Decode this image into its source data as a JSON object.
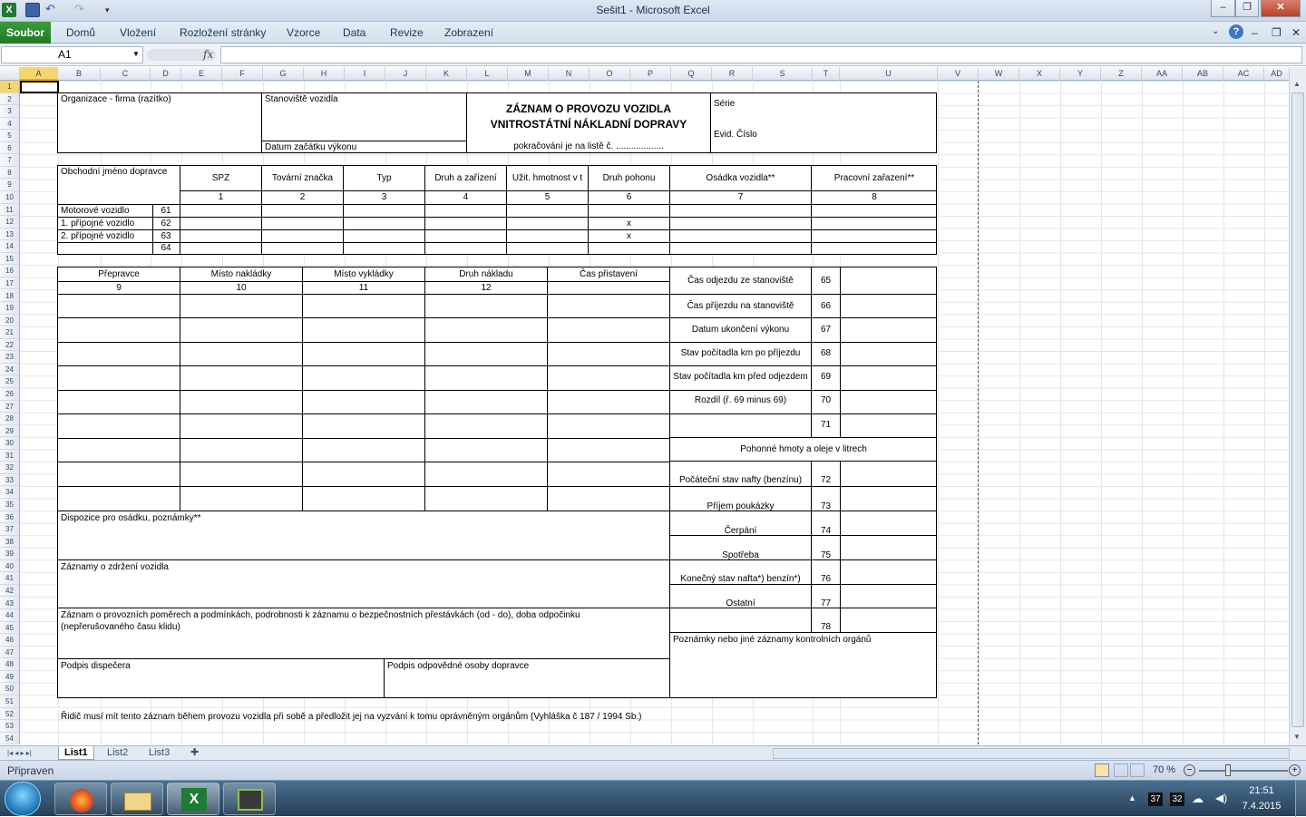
{
  "window": {
    "title": "Sešit1 - Microsoft Excel"
  },
  "ribbon": {
    "file": "Soubor",
    "tabs": [
      "Domů",
      "Vložení",
      "Rozložení stránky",
      "Vzorce",
      "Data",
      "Revize",
      "Zobrazení"
    ]
  },
  "formula_bar": {
    "name_box": "A1",
    "fx": "fx",
    "content": ""
  },
  "columns": [
    "A",
    "B",
    "C",
    "D",
    "E",
    "F",
    "G",
    "H",
    "I",
    "J",
    "K",
    "L",
    "M",
    "N",
    "O",
    "P",
    "Q",
    "R",
    "S",
    "T",
    "U",
    "V",
    "W",
    "X",
    "Y",
    "Z",
    "AA",
    "AB",
    "AC",
    "AD"
  ],
  "form": {
    "org": "Organizace - firma (razítko)",
    "stanoviste": "Stanoviště vozidla",
    "datum_zacatku": "Datum začátku výkonu",
    "title1": "ZÁZNAM O PROVOZU VOZIDLA",
    "title2": "VNITROSTÁTNÍ NÁKLADNÍ DOPRAVY",
    "pokracovani": "pokračování je na listě č. ...................",
    "serie": "Série",
    "evid": "Evid. Číslo",
    "obchodni": "Obchodní jméno dopravce",
    "veh_headers": [
      "SPZ",
      "Tovární značka",
      "Typ",
      "Druh a zařízení",
      "Užit. hmotnost v t",
      "Druh pohonu",
      "Osádka vozidla**",
      "Pracovní zařazení**"
    ],
    "veh_nums": [
      "1",
      "2",
      "3",
      "4",
      "5",
      "6",
      "7",
      "8"
    ],
    "veh_rows": [
      {
        "label": "Motorové vozidlo",
        "num": "61"
      },
      {
        "label": "1. přípojné vozidlo",
        "num": "62"
      },
      {
        "label": "2. přípojné vozidlo",
        "num": "63"
      },
      {
        "label": "",
        "num": "64"
      }
    ],
    "x_mark": "x",
    "cargo_headers": [
      "Přepravce",
      "Místo nakládky",
      "Místo vykládky",
      "Druh nákladu",
      "Čas přistavení"
    ],
    "cargo_nums": [
      "9",
      "10",
      "11",
      "12",
      ""
    ],
    "right_rows": [
      {
        "label": "Čas odjezdu ze stanoviště",
        "num": "65"
      },
      {
        "label": "Čas příjezdu na stanoviště",
        "num": "66"
      },
      {
        "label": "Datum ukončení výkonu",
        "num": "67"
      },
      {
        "label": "Stav počítadla km po příjezdu",
        "num": "68"
      },
      {
        "label": "Stav počítadla km před odjezdem",
        "num": "69"
      },
      {
        "label": "Rozdíl (ř. 69 minus 69)",
        "num": "70"
      },
      {
        "label": "",
        "num": "71"
      }
    ],
    "pohonne": "Pohonné hmoty a oleje v litrech",
    "fuel_rows": [
      {
        "label": "Počáteční stav nafty (benzínu)",
        "num": "72"
      },
      {
        "label": "Příjem poukázky",
        "num": "73"
      },
      {
        "label": "Čerpání",
        "num": "74"
      },
      {
        "label": "Spotřeba",
        "num": "75"
      },
      {
        "label": "Konečný stav nafta*) benzín*)",
        "num": "76"
      },
      {
        "label": "Ostatní",
        "num": "77"
      },
      {
        "label": "",
        "num": "78"
      }
    ],
    "dispozice": "Dispozice pro osádku, poznámky**",
    "zdrzeni": "Záznamy o zdržení vozidla",
    "provozni1": "Záznam o provozních poměrech a podmínkách, podrobnosti k záznamu o bezpečnostních přestávkách (od - do), doba odpočinku",
    "provozni2": "(nepřerušovaného času klidu)",
    "poznamky_org": "Poznámky nebo jiné záznamy kontrolních orgánů",
    "podpis_disp": "Podpis dispečera",
    "podpis_odp": "Podpis odpovědné osoby dopravce",
    "footer": "Řidič musí mít tento záznam během provozu vozidla při sobě a předložit jej na vyzvání k tomu oprávněným orgánům (Vyhláška č 187 / 1994 Sb.)"
  },
  "sheets": [
    "List1",
    "List2",
    "List3"
  ],
  "status": {
    "ready": "Připraven",
    "zoom": "70 %"
  },
  "taskbar": {
    "time": "21:51",
    "date": "7.4.2015",
    "tray1": "37",
    "tray2": "32"
  }
}
